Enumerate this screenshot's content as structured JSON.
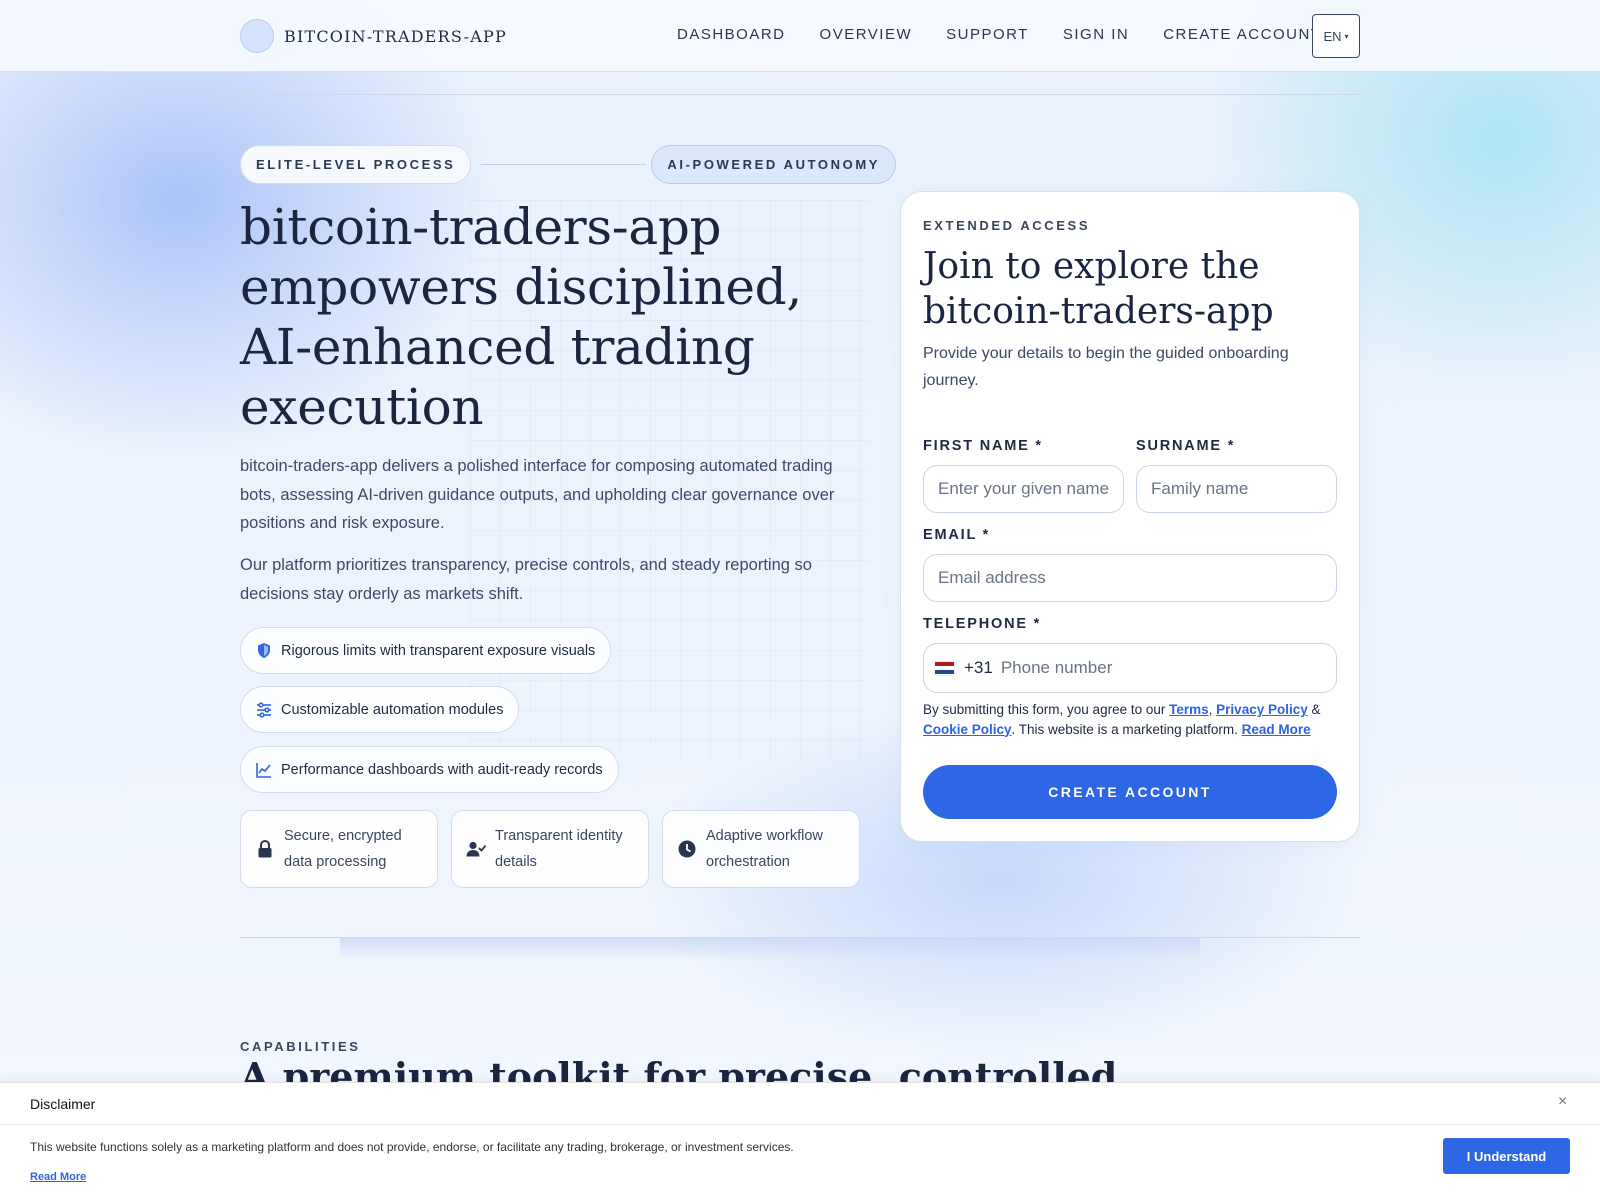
{
  "header": {
    "logo_text": "BITCOIN-TRADERS-APP",
    "nav": [
      {
        "label": "DASHBOARD"
      },
      {
        "label": "OVERVIEW"
      },
      {
        "label": "SUPPORT"
      },
      {
        "label": "SIGN IN"
      },
      {
        "label": "CREATE ACCOUNT"
      }
    ],
    "lang": "EN",
    "lang_caret": "▾"
  },
  "hero": {
    "pill_1": "ELITE-LEVEL PROCESS",
    "pill_2": "AI-POWERED AUTONOMY",
    "title": "bitcoin-traders-app empowers disciplined, AI-enhanced trading execution",
    "paragraph_1": "bitcoin-traders-app delivers a polished interface for composing automated trading bots, assessing AI-driven guidance outputs, and upholding clear governance over positions and risk exposure.",
    "paragraph_2": "Our platform prioritizes transparency, precise controls, and steady reporting so decisions stay orderly as markets shift.",
    "features": [
      {
        "icon": "shield-icon",
        "label": "Rigorous limits with transparent exposure visuals"
      },
      {
        "icon": "sliders-icon",
        "label": "Customizable automation modules"
      },
      {
        "icon": "chart-line-icon",
        "label": "Performance dashboards with audit-ready records"
      }
    ],
    "cards": [
      {
        "icon": "lock-icon",
        "label": "Secure, encrypted data processing"
      },
      {
        "icon": "user-check-icon",
        "label": "Transparent identity details"
      },
      {
        "icon": "clock-icon",
        "label": "Adaptive workflow orchestration"
      }
    ]
  },
  "form": {
    "eyebrow": "EXTENDED ACCESS",
    "title": "Join to explore the bitcoin-traders-app",
    "subtitle": "Provide your details to begin the guided onboarding journey.",
    "first_name_label": "FIRST NAME *",
    "first_name_placeholder": "Enter your given name",
    "surname_label": "SURNAME *",
    "surname_placeholder": "Family name",
    "email_label": "EMAIL *",
    "email_placeholder": "Email address",
    "phone_label": "TELEPHONE *",
    "dial_code": "+31",
    "phone_placeholder": "Phone number",
    "consent_prefix": "By submitting this form, you agree to our ",
    "terms": "Terms",
    "comma": ", ",
    "privacy": "Privacy Policy",
    "amp": " & ",
    "cookie": "Cookie Policy",
    "consent_mid": ". This website is a marketing platform. ",
    "read_more": "Read More",
    "submit": "CREATE ACCOUNT"
  },
  "capabilities": {
    "eyebrow": "CAPABILITIES",
    "title": "A premium toolkit for precise, controlled"
  },
  "disclaimer": {
    "title": "Disclaimer",
    "close": "×",
    "text": "This website functions solely as a marketing platform and does not provide, endorse, or facilitate any trading, brokerage, or investment services.",
    "read_more": "Read More",
    "button": "I Understand"
  },
  "colors": {
    "accent": "#2d67e6",
    "text_dark": "#1a2540"
  }
}
